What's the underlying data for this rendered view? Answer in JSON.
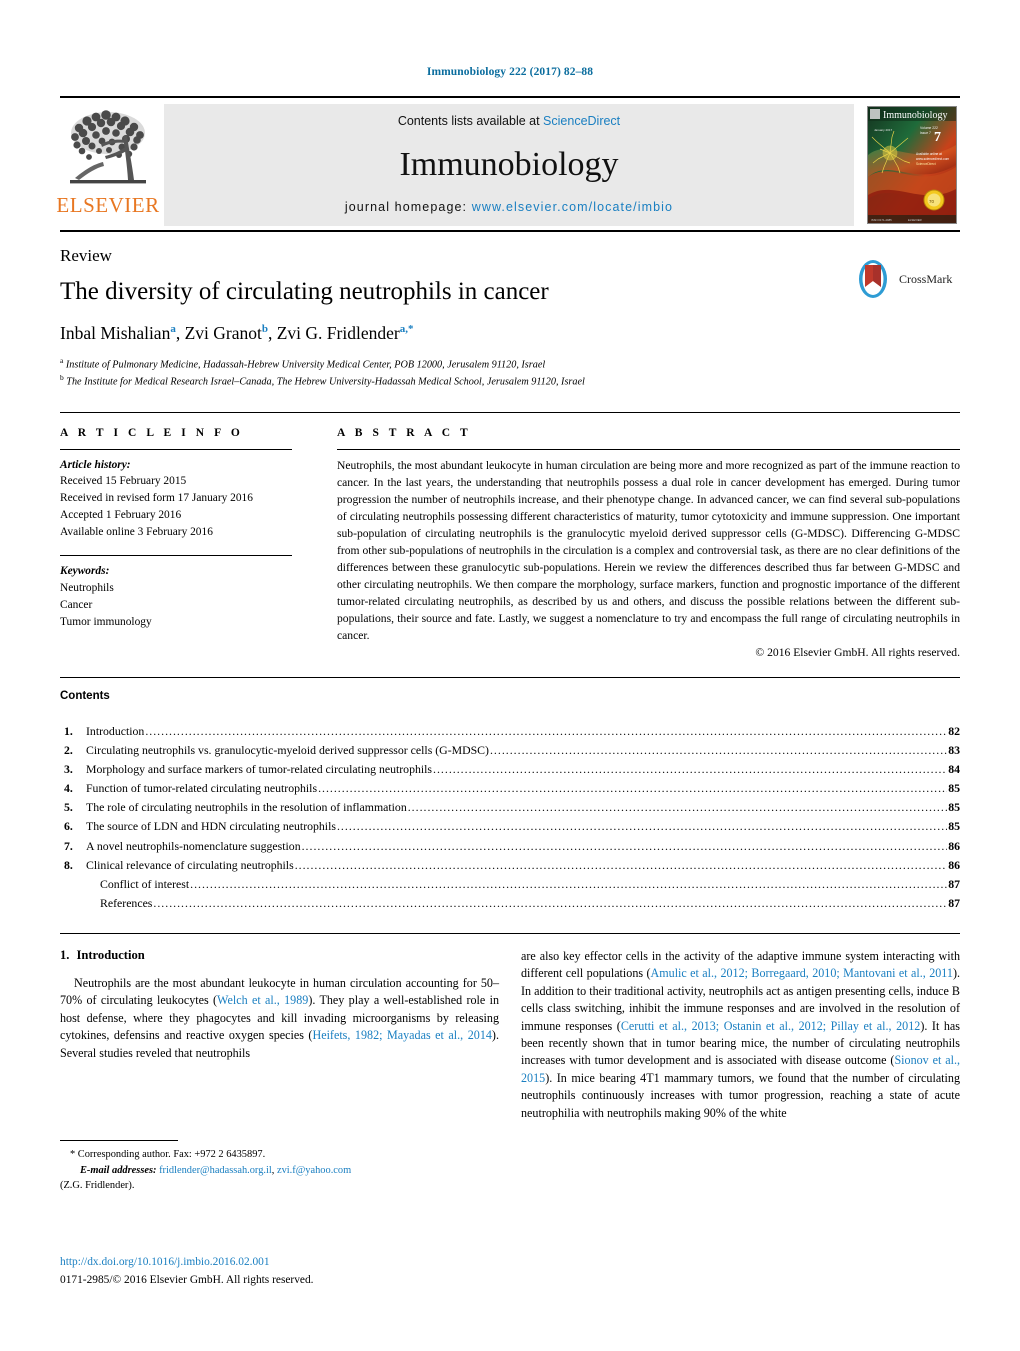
{
  "running_head": "Immunobiology 222 (2017) 82–88",
  "masthead": {
    "publisher": "ELSEVIER",
    "contents_prefix": "Contents lists available at ",
    "contents_link": "ScienceDirect",
    "journal_title": "Immunobiology",
    "homepage_prefix": "journal homepage: ",
    "homepage_url": "www.elsevier.com/locate/imbio",
    "cover_title": "Immunobiology",
    "cover_issue": "7"
  },
  "article": {
    "doctype": "Review",
    "title": "The diversity of circulating neutrophils in cancer",
    "authors": [
      {
        "name": "Inbal Mishalian",
        "sup": "a"
      },
      {
        "name": "Zvi Granot",
        "sup": "b"
      },
      {
        "name": "Zvi G. Fridlender",
        "sup": "a,*"
      }
    ],
    "affiliations": [
      {
        "mark": "a",
        "text": "Institute of Pulmonary Medicine, Hadassah-Hebrew University Medical Center, POB 12000, Jerusalem 91120, Israel"
      },
      {
        "mark": "b",
        "text": "The Institute for Medical Research Israel–Canada, The Hebrew University-Hadassah Medical School, Jerusalem 91120, Israel"
      }
    ],
    "crossmark_label": "CrossMark"
  },
  "info": {
    "heading": "A R T I C L E  I N F O",
    "history_label": "Article history:",
    "history": [
      "Received 15 February 2015",
      "Received in revised form 17 January 2016",
      "Accepted 1 February 2016",
      "Available online 3 February 2016"
    ],
    "keywords_label": "Keywords:",
    "keywords": [
      "Neutrophils",
      "Cancer",
      "Tumor immunology"
    ]
  },
  "abstract": {
    "heading": "A B S T R A C T",
    "text": "Neutrophils, the most abundant leukocyte in human circulation are being more and more recognized as part of the immune reaction to cancer. In the last years, the understanding that neutrophils possess a dual role in cancer development has emerged. During tumor progression the number of neutrophils increase, and their phenotype change. In advanced cancer, we can find several sub-populations of circulating neutrophils possessing different characteristics of maturity, tumor cytotoxicity and immune suppression. One important sub-population of circulating neutrophils is the granulocytic myeloid derived suppressor cells (G-MDSC). Differencing G-MDSC from other sub-populations of neutrophils in the circulation is a complex and controversial task, as there are no clear definitions of the differences between these granulocytic sub-populations. Herein we review the differences described thus far between G-MDSC and other circulating neutrophils. We then compare the morphology, surface markers, function and prognostic importance of the different tumor-related circulating neutrophils, as described by us and others, and discuss the possible relations between the different sub-populations, their source and fate. Lastly, we suggest a nomenclature to try and encompass the full range of circulating neutrophils in cancer.",
    "copyright": "© 2016 Elsevier GmbH. All rights reserved."
  },
  "contents": {
    "title": "Contents",
    "entries": [
      {
        "num": "1.",
        "label": "Introduction",
        "page": "82"
      },
      {
        "num": "2.",
        "label": "Circulating neutrophils vs. granulocytic-myeloid derived suppressor cells (G-MDSC)",
        "page": "83"
      },
      {
        "num": "3.",
        "label": "Morphology and surface markers of tumor-related circulating neutrophils",
        "page": "84"
      },
      {
        "num": "4.",
        "label": "Function of tumor-related circulating neutrophils",
        "page": "85"
      },
      {
        "num": "5.",
        "label": "The role of circulating neutrophils in the resolution of inflammation",
        "page": "85"
      },
      {
        "num": "6.",
        "label": "The source of LDN and HDN circulating neutrophils",
        "page": "85"
      },
      {
        "num": "7.",
        "label": "A novel neutrophils-nomenclature suggestion",
        "page": "86"
      },
      {
        "num": "8.",
        "label": "Clinical relevance of circulating neutrophils",
        "page": "86"
      },
      {
        "num": "",
        "label": "Conflict of interest",
        "page": "87",
        "indent": true
      },
      {
        "num": "",
        "label": "References",
        "page": "87",
        "indent": true
      }
    ],
    "dot_fill": "................................................................................................................................................................................................................................"
  },
  "body": {
    "section_number": "1.",
    "section_title": "Introduction",
    "left_p1_a": "Neutrophils are the most abundant leukocyte in human circulation accounting for 50–70% of circulating leukocytes (",
    "left_ref1": "Welch et al., 1989",
    "left_p1_b": "). They play a well-established role in host defense, where they phagocytes and kill invading microorganisms by releasing cytokines, defensins and reactive oxygen species (",
    "left_ref2": "Heifets, 1982; Mayadas et al., 2014",
    "left_p1_c": "). Several studies reveled that neutrophils",
    "right_p1_a": "are also key effector cells in the activity of the adaptive immune system interacting with different cell populations (",
    "right_ref1": "Amulic et al., 2012; Borregaard, 2010; Mantovani et al., 2011",
    "right_p1_b": "). In addition to their traditional activity, neutrophils act as antigen presenting cells, induce B cells class switching, inhibit the immune responses and are involved in the resolution of immune responses (",
    "right_ref2": "Cerutti et al., 2013; Ostanin et al., 2012; Pillay et al., 2012",
    "right_p1_c": "). It has been recently shown that in tumor bearing mice, the number of circulating neutrophils increases with tumor development and is associated with disease outcome (",
    "right_ref3": "Sionov et al., 2015",
    "right_p1_d": "). In mice bearing 4T1 mammary tumors, we found that the number of circulating neutrophils continuously increases with tumor progression, reaching a state of acute neutrophilia with neutrophils making 90% of the white"
  },
  "footnotes": {
    "corresponding": "* Corresponding author. Fax: +972 2 6435897.",
    "email_label": "E-mail addresses:",
    "email1": "fridlender@hadassah.org.il",
    "email2": "zvi.f@yahoo.com",
    "email_attrib": "(Z.G. Fridlender).",
    "doi": "http://dx.doi.org/10.1016/j.imbio.2016.02.001",
    "issn": "0171-2985/© 2016 Elsevier GmbH. All rights reserved."
  },
  "colors": {
    "link": "#1a7fc1",
    "running_head": "#0b6d9e",
    "elsevier_orange": "#e87722",
    "panel_gray": "#e9e9e9"
  }
}
